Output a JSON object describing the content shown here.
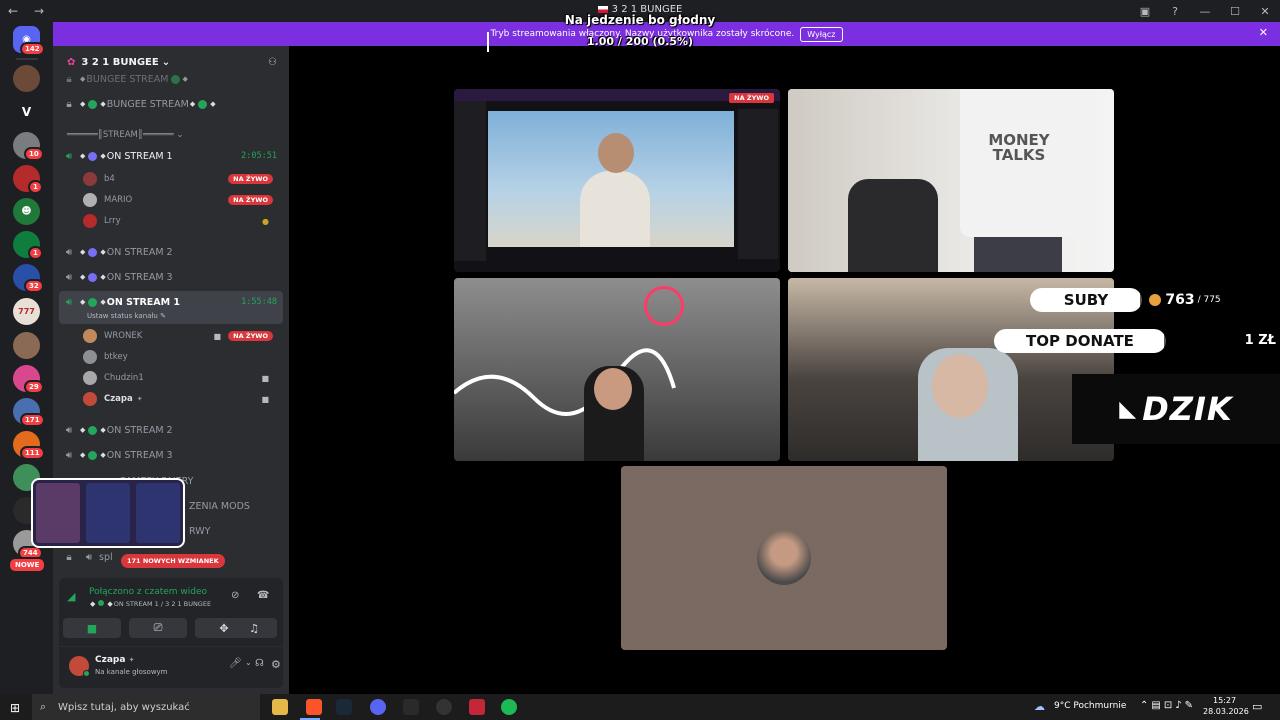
{
  "window": {
    "title": "3 2 1 BUNGEE"
  },
  "overlay": {
    "line1": "Na jedzenie bo głodny",
    "line2": "1.00 / 200 (0.5%)",
    "progress": 0.005
  },
  "banner": {
    "text": "Tryb streamowania włączony. Nazwy użytkownika zostały skrócone.",
    "button": "Wyłącz"
  },
  "rail": {
    "badges": [
      "142",
      "10",
      "1",
      "1",
      "32",
      "29",
      "171",
      "111",
      "744"
    ],
    "letter": "V",
    "new_label": "NOWE"
  },
  "server": {
    "name": "3 2 1 BUNGEE"
  },
  "channels": {
    "stream_top": "BUNGEE STREAM",
    "stream_locked": "BUNGEE STREAM",
    "category": "STREAM",
    "on_stream_1a": {
      "name": "ON STREAM 1",
      "timer": "2:05:51"
    },
    "on_stream_1a_users": [
      {
        "name": "b4",
        "live": "NA ŻYWO"
      },
      {
        "name": "MARIO",
        "live": "NA ŻYWO"
      },
      {
        "name": "Lrry",
        "live": ""
      }
    ],
    "on_stream_2a": "ON STREAM 2",
    "on_stream_3a": "ON STREAM 3",
    "on_stream_1b": {
      "name": "ON STREAM 1",
      "timer": "1:55:48",
      "status": "Ustaw status kanału"
    },
    "on_stream_1b_users": [
      {
        "name": "WRONEK",
        "live": "NA ŻYWO"
      },
      {
        "name": "btkey",
        "live": ""
      },
      {
        "name": "Chudzin1",
        "live": ""
      },
      {
        "name": "Czapa",
        "live": ""
      }
    ],
    "on_stream_2b": "ON STREAM 2",
    "on_stream_3b": "ON STREAM 3",
    "partial1": "CAMERY PAJERY",
    "partial2": "ZENIA MODS",
    "partial3": "RWY",
    "partial4": "spl",
    "mentions": "171 NOWYCH WZMIANEK"
  },
  "voice": {
    "title": "Połączono z czatem wideo",
    "subtitle": "ON STREAM 1 / 3 2 1 BUNGEE"
  },
  "user": {
    "name": "Czapa",
    "status": "Na kanale głosowym"
  },
  "stage": {
    "tile_live": "NA ŻYWO",
    "shirt_text": "MONEY TALKS",
    "suby_label": "SUBY",
    "suby_count": "763",
    "suby_goal": "/ 775",
    "top_donate": "TOP DONATE",
    "donate_amount": "1 ZŁ",
    "dzik_logo": "DZIK"
  },
  "taskbar": {
    "search": "Wpisz tutaj, aby wyszukać",
    "weather": "9°C  Pochmurnie",
    "time": "15:27",
    "date": "28.03.2026"
  },
  "colors": {
    "banner": "#7b2fe0",
    "live": "#da373c",
    "online": "#23a55a"
  }
}
